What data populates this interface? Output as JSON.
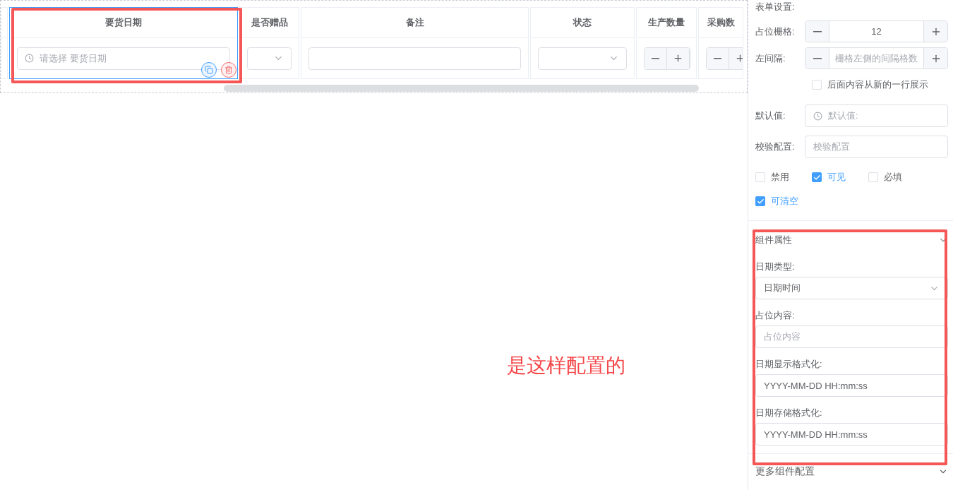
{
  "table": {
    "columns": [
      {
        "kind": "blank",
        "selected": false
      },
      {
        "kind": "date",
        "title": "要货日期",
        "placeholder": "请选择 要货日期",
        "selected": true
      },
      {
        "kind": "select",
        "title": "是否赠品",
        "selected": false
      },
      {
        "kind": "text",
        "title": "备注",
        "selected": false
      },
      {
        "kind": "select",
        "title": "状态",
        "selected": false
      },
      {
        "kind": "number",
        "title": "生产数量",
        "selected": false
      },
      {
        "kind": "number",
        "title": "采购数",
        "selected": false
      }
    ]
  },
  "annotation": {
    "note": "是这样配置的"
  },
  "form_settings": {
    "title": "表单设置:",
    "span": {
      "label": "占位栅格:",
      "value": "12"
    },
    "offset": {
      "label": "左间隔:",
      "placeholder": "栅格左侧的间隔格数"
    },
    "new_line": {
      "label": "后面内容从新的一行展示",
      "checked": false
    },
    "default": {
      "label": "默认值:",
      "placeholder": "默认值:"
    },
    "validation": {
      "label": "校验配置:",
      "placeholder": "校验配置"
    },
    "flags": [
      {
        "label": "禁用",
        "checked": false
      },
      {
        "label": "可见",
        "checked": true
      },
      {
        "label": "必填",
        "checked": false
      },
      {
        "label": "可清空",
        "checked": true
      }
    ]
  },
  "component_props": {
    "title": "组件属性",
    "fields": [
      {
        "kind": "select",
        "label": "日期类型:",
        "value": "日期时间"
      },
      {
        "kind": "input",
        "label": "占位内容:",
        "placeholder": "占位内容"
      },
      {
        "kind": "input",
        "label": "日期显示格式化:",
        "value": "YYYY-MM-DD HH:mm:ss"
      },
      {
        "kind": "input",
        "label": "日期存储格式化:",
        "value": "YYYY-MM-DD HH:mm:ss"
      }
    ]
  },
  "more": {
    "title": "更多组件配置"
  }
}
